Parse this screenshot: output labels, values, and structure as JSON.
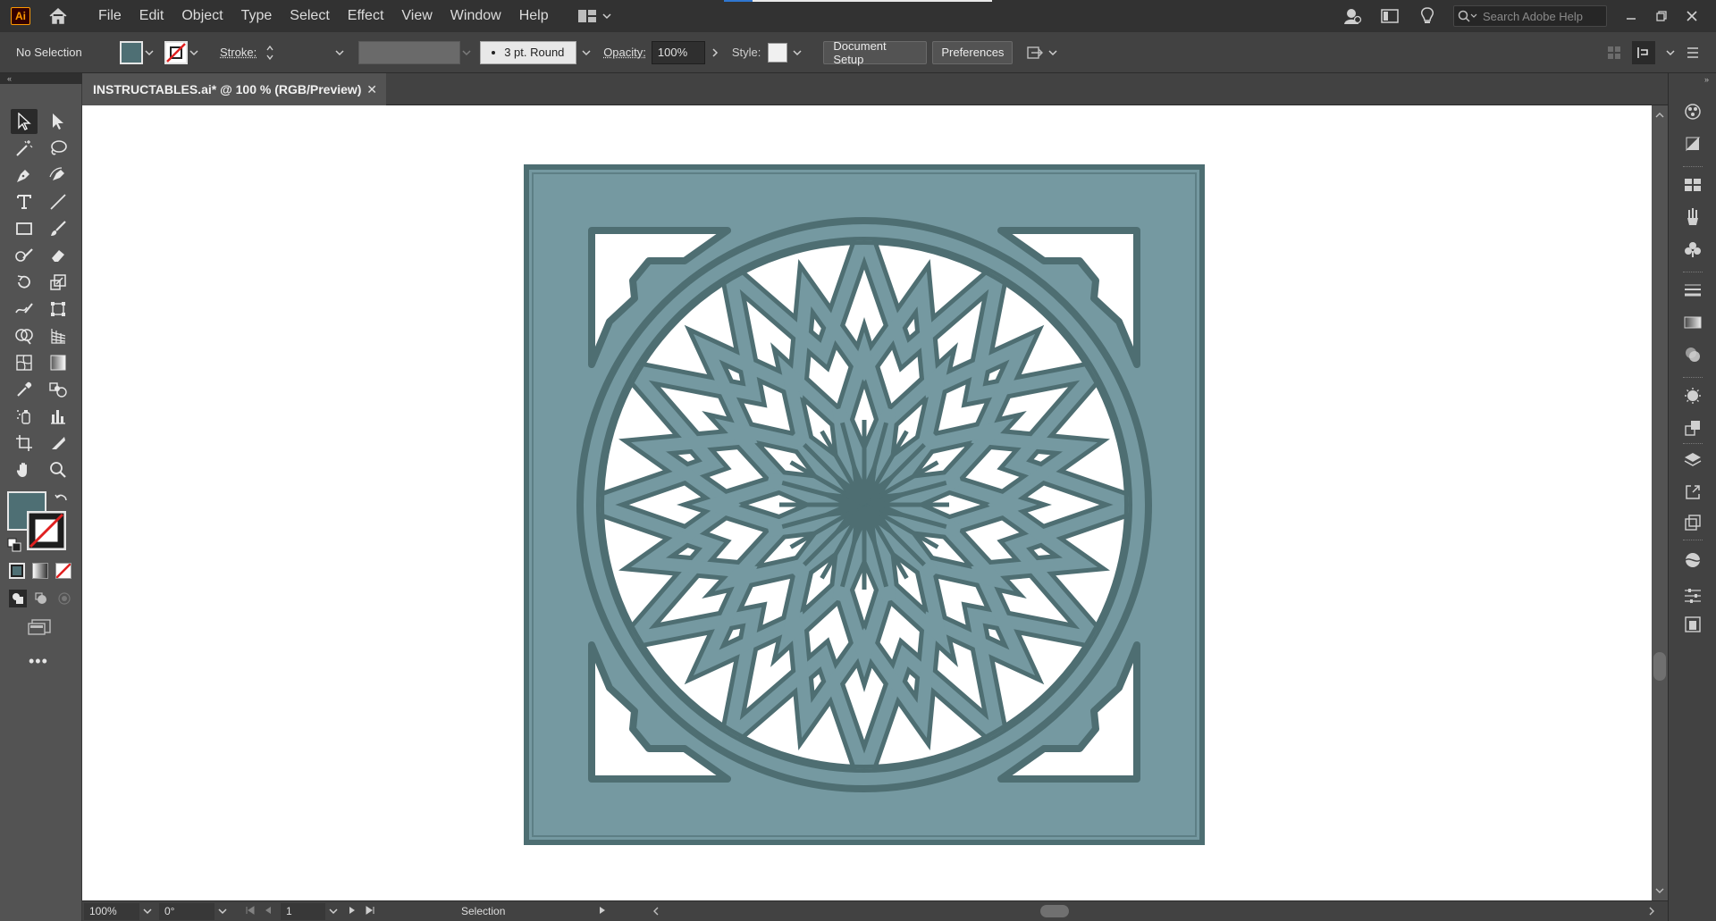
{
  "app": {
    "logo_text": "Ai",
    "menu": [
      "File",
      "Edit",
      "Object",
      "Type",
      "Select",
      "Effect",
      "View",
      "Window",
      "Help"
    ],
    "search_placeholder": "Search Adobe Help"
  },
  "control_bar": {
    "selection_label": "No Selection",
    "stroke_label": "Stroke:",
    "stroke_profile": "3 pt. Round",
    "opacity_label": "Opacity:",
    "opacity_value": "100%",
    "style_label": "Style:",
    "document_setup_label": "Document Setup",
    "preferences_label": "Preferences"
  },
  "document": {
    "tab_title": "INSTRUCTABLES.ai* @ 100 % (RGB/Preview)",
    "close_glyph": "✕"
  },
  "status_bar": {
    "zoom": "100%",
    "rotation": "0°",
    "artboard_number": "1",
    "tool_name": "Selection"
  },
  "colors": {
    "fill": "#4e6f74",
    "panel_fill": "#7599a1",
    "panel_stroke": "#4d6e72",
    "lattice_stroke": "#4e6e72",
    "lattice_fill": "#7599a1"
  },
  "tools": [
    "selection-tool",
    "direct-selection-tool",
    "magic-wand-tool",
    "lasso-tool",
    "pen-tool",
    "curvature-tool",
    "type-tool",
    "line-segment-tool",
    "rectangle-tool",
    "paintbrush-tool",
    "shaper-tool",
    "eraser-tool",
    "rotate-tool",
    "scale-tool",
    "warp-tool",
    "free-transform-tool",
    "shape-builder-tool",
    "perspective-grid-tool",
    "mesh-tool",
    "gradient-tool",
    "eyedropper-tool",
    "blend-tool",
    "symbol-sprayer-tool",
    "column-graph-tool",
    "artboard-tool",
    "slice-tool",
    "hand-tool",
    "zoom-tool"
  ],
  "right_dock": [
    "color-guide-icon",
    "color-icon",
    "swatches-icon",
    "brushes-icon",
    "symbols-icon",
    "stroke-icon",
    "gradient-icon",
    "transparency-icon",
    "appearance-icon",
    "graphic-styles-icon",
    "layers-icon",
    "export-icon",
    "artboards-icon",
    "libraries-icon",
    "properties-icon",
    "asset-export-icon"
  ]
}
